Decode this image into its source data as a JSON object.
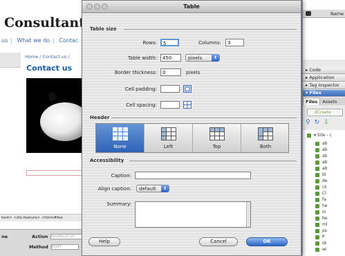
{
  "background": {
    "site_title": "Consultants",
    "nav": [
      "us",
      "What we do",
      "Contac"
    ],
    "breadcrumb": "Home / Contact us /",
    "heading": "Contact us",
    "tag_bar": "tent> <div.feature> <form#fee",
    "props": {
      "row1_label": "ne",
      "action_label": "Action",
      "action_value": "feedback.ph",
      "method_label": "Method",
      "method_value": "POST"
    }
  },
  "right_panel": {
    "column_name": "Name",
    "panels": [
      "Code",
      "Application",
      "Tag Inspector",
      "Files"
    ],
    "tabs": [
      "Files",
      "Assets"
    ],
    "create_label": "dCreate",
    "site_label": "Site - c",
    "file_rows": [
      "ab",
      "ab",
      "ab",
      "ab",
      "ab",
      "bl",
      "de",
      "ck",
      "Cl",
      "fa",
      "he",
      "in",
      "be",
      "ml",
      "ps",
      "P",
      "sk",
      "wi",
      "wi"
    ]
  },
  "dialog": {
    "title": "Table",
    "table_size_label": "Table size",
    "rows_label": "Rows:",
    "rows_value": "5",
    "columns_label": "Columns:",
    "columns_value": "3",
    "width_label": "Table width:",
    "width_value": "450",
    "width_unit": "pixels",
    "border_label": "Border thickness:",
    "border_value": "0",
    "border_unit": "pixels",
    "padding_label": "Cell padding:",
    "padding_value": "",
    "spacing_label": "Cell spacing:",
    "spacing_value": "",
    "header_label": "Header",
    "header_options": [
      "None",
      "Left",
      "Top",
      "Both"
    ],
    "header_selected": "None",
    "accessibility_label": "Accessibility",
    "caption_label": "Caption:",
    "caption_value": "",
    "align_label": "Align caption:",
    "align_value": "default",
    "summary_label": "Summary:",
    "help_label": "Help",
    "cancel_label": "Cancel",
    "ok_label": "OK"
  },
  "colors": {
    "accent": "#3c6fbd",
    "selected_segment": "#2f63b6",
    "link": "#3a6aa8"
  }
}
